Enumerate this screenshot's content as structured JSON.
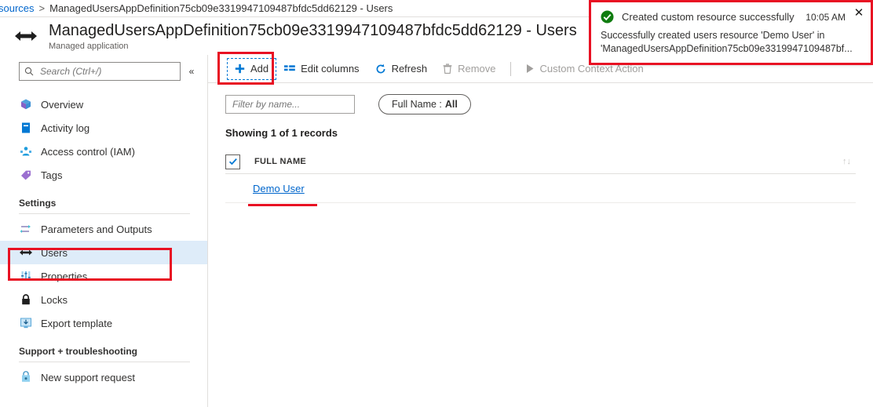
{
  "breadcrumb": {
    "link": "sources",
    "separator": ">",
    "current": "ManagedUsersAppDefinition75cb09e3319947109487bfdc5dd62129 - Users"
  },
  "header": {
    "icon": "managed-application-icon",
    "title": "ManagedUsersAppDefinition75cb09e3319947109487bfdc5dd62129 - Users",
    "subtitle": "Managed application"
  },
  "sidebar": {
    "search": {
      "placeholder": "Search (Ctrl+/)",
      "value": "",
      "icon": "search-icon"
    },
    "collapse_icon": "«",
    "items": [
      {
        "label": "Overview",
        "icon": "overview-icon",
        "selected": false
      },
      {
        "label": "Activity log",
        "icon": "activity-log-icon",
        "selected": false
      },
      {
        "label": "Access control (IAM)",
        "icon": "access-control-icon",
        "selected": false
      },
      {
        "label": "Tags",
        "icon": "tags-icon",
        "selected": false
      }
    ],
    "groups": [
      {
        "label": "Settings",
        "items": [
          {
            "label": "Parameters and Outputs",
            "icon": "parameters-icon",
            "selected": false
          },
          {
            "label": "Users",
            "icon": "users-icon",
            "selected": true
          },
          {
            "label": "Properties",
            "icon": "properties-icon",
            "selected": false
          },
          {
            "label": "Locks",
            "icon": "lock-icon",
            "selected": false
          },
          {
            "label": "Export template",
            "icon": "export-template-icon",
            "selected": false
          }
        ]
      },
      {
        "label": "Support + troubleshooting",
        "items": [
          {
            "label": "New support request",
            "icon": "support-request-icon",
            "selected": false
          }
        ]
      }
    ]
  },
  "toolbar": {
    "add": {
      "label": "Add",
      "icon": "plus-icon",
      "disabled": false
    },
    "edit_columns": {
      "label": "Edit columns",
      "icon": "columns-icon",
      "disabled": false
    },
    "refresh": {
      "label": "Refresh",
      "icon": "refresh-icon",
      "disabled": false
    },
    "remove": {
      "label": "Remove",
      "icon": "trash-icon",
      "disabled": true
    },
    "custom_action": {
      "label": "Custom Context Action",
      "icon": "play-icon",
      "disabled": true
    }
  },
  "filters": {
    "name_filter": {
      "placeholder": "Filter by name...",
      "value": ""
    },
    "pill": {
      "label": "Full Name :",
      "value": "All"
    }
  },
  "records": {
    "summary": "Showing 1 of 1 records"
  },
  "table": {
    "select_all_checked": true,
    "sort_icon": "↑↓",
    "columns": [
      "FULL NAME"
    ],
    "rows": [
      {
        "full_name": "Demo User"
      }
    ]
  },
  "notification": {
    "status_icon": "success-check-icon",
    "title": "Created custom resource successfully",
    "time": "10:05 AM",
    "body_line1": "Successfully created users resource 'Demo User' in",
    "body_line2": "'ManagedUsersAppDefinition75cb09e3319947109487bf...",
    "close_icon": "✕"
  },
  "colors": {
    "accent": "#0078d4",
    "link": "#0066cc",
    "annotation": "#e81123",
    "success": "#107c10",
    "selected_row": "#deecf9"
  }
}
